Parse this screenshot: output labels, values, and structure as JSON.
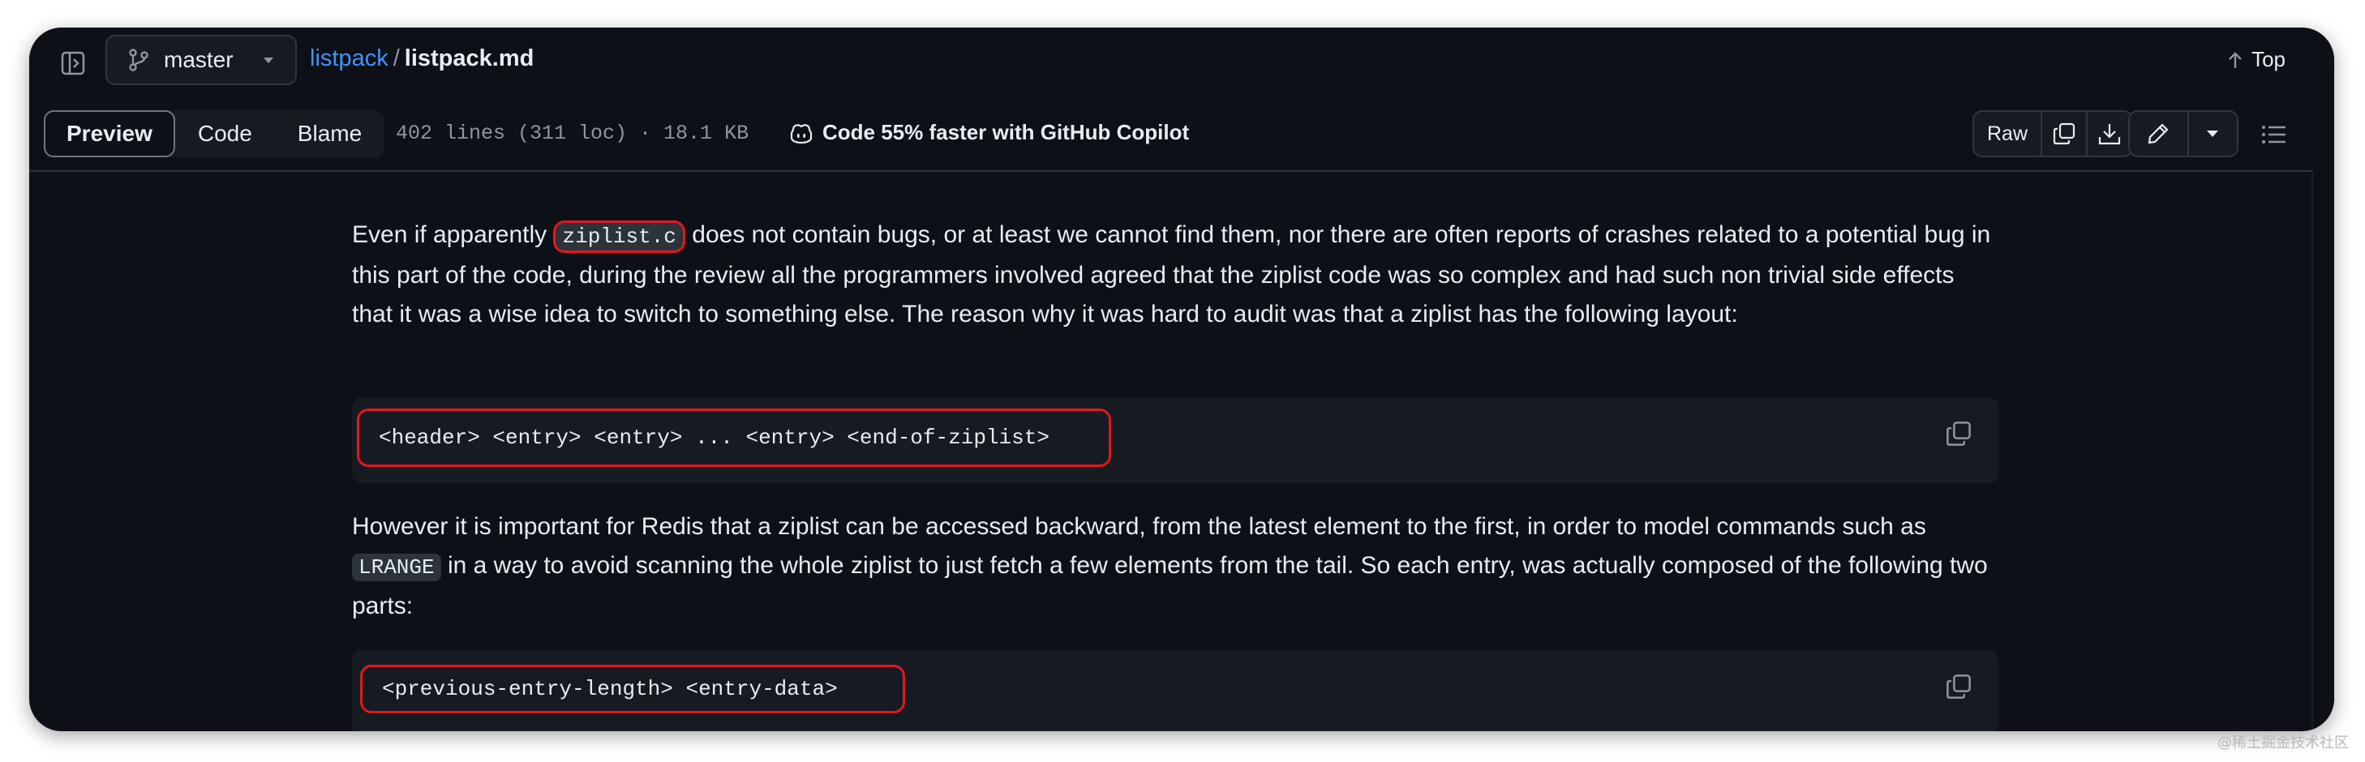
{
  "header": {
    "branch": "master",
    "repo_link": "listpack",
    "separator": "/",
    "file_name": "listpack.md",
    "top_label": "Top"
  },
  "toolbar": {
    "tabs": [
      {
        "label": "Preview",
        "active": true
      },
      {
        "label": "Code",
        "active": false
      },
      {
        "label": "Blame",
        "active": false
      }
    ],
    "file_meta": "402 lines (311 loc) · 18.1 KB",
    "copilot_text": "Code 55% faster with GitHub Copilot",
    "raw_label": "Raw",
    "icons": [
      "copy-icon",
      "download-icon",
      "pencil-icon",
      "triangle-down-icon",
      "list-icon"
    ]
  },
  "content": {
    "p1_before": "Even if apparently ",
    "p1_code": "ziplist.c",
    "p1_after": " does not contain bugs, or at least we cannot find them, nor there are often reports of crashes related to a potential bug in this part of the code, during the review all the programmers involved agreed that the ziplist code was so complex and had such non trivial side effects that it was a wise idea to switch to something else. The reason why it was hard to audit was that a ziplist has the following layout:",
    "code1": "<header> <entry> <entry> ... <entry> <end-of-ziplist>",
    "p2_before": "However it is important for Redis that a ziplist can be accessed backward, from the latest element to the first, in order to model commands such as ",
    "p2_code": "LRANGE",
    "p2_after": " in a way to avoid scanning the whole ziplist to just fetch a few elements from the tail. So each entry, was actually composed of the following two parts:",
    "code2": "<previous-entry-length> <entry-data>"
  },
  "colors": {
    "background": "#0d1117",
    "text": "#e6edf3",
    "link": "#4493f8",
    "highlight_border": "#e5161d",
    "code_block_bg": "#161b22"
  },
  "watermark": "@稀土掘金技术社区"
}
